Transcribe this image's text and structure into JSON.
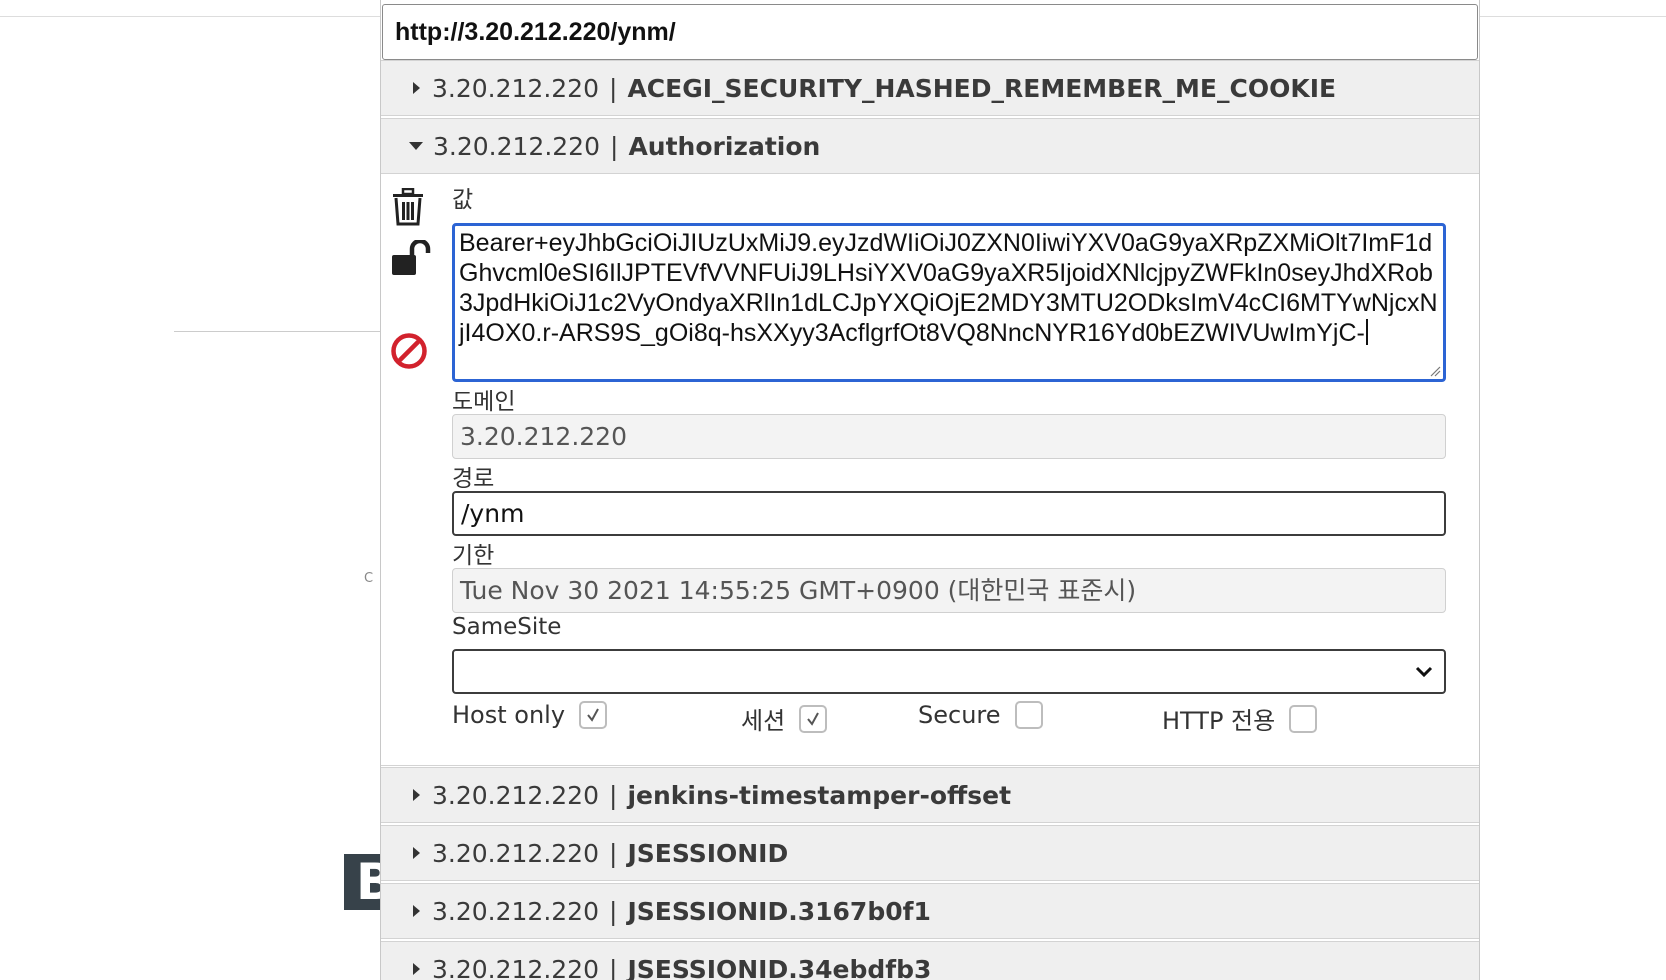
{
  "url": "http://3.20.212.220/ynm/",
  "background": {
    "glyph_small": "C",
    "glyph_block": "B"
  },
  "cookies_before": [
    {
      "domain": "3.20.212.220",
      "name": "ACEGI_SECURITY_HASHED_REMEMBER_ME_COOKIE"
    }
  ],
  "expanded_cookie": {
    "domain": "3.20.212.220",
    "name": "Authorization",
    "icons": {
      "delete": "trash-icon",
      "lock": "unlock-icon",
      "block": "block-icon"
    },
    "value_label": "값",
    "value": "Bearer+eyJhbGciOiJIUzUxMiJ9.eyJzdWIiOiJ0ZXN0IiwiYXV0aG9yaXRpZXMiOlt7ImF1dGhvcml0eSI6IlJPTEVfVVNFUiJ9LHsiYXV0aG9yaXR5IjoidXNlcjpyZWFkIn0seyJhdXRob3JpdHkiOiJ1c2VyOndyaXRlIn1dLCJpYXQiOjE2MDY3MTU2ODksImV4cCI6MTYwNjcxNjI4OX0.r-ARS9S_gOi8q-hsXXyy3AcflgrfOt8VQ8NncNYR16Yd0bEZWIVUwImYjC-",
    "domain_label": "도메인",
    "domain_value": "3.20.212.220",
    "path_label": "경로",
    "path_value": "/ynm",
    "expires_label": "기한",
    "expires_value": "Tue Nov 30 2021 14:55:25 GMT+0900 (대한민국 표준시)",
    "samesite_label": "SameSite",
    "samesite_value": "",
    "flags": {
      "host_only_label": "Host only",
      "host_only": true,
      "session_label": "세션",
      "session": true,
      "secure_label": "Secure",
      "secure": false,
      "http_only_label": "HTTP 전용",
      "http_only": false
    }
  },
  "cookies_after": [
    {
      "domain": "3.20.212.220",
      "name": "jenkins-timestamper-offset"
    },
    {
      "domain": "3.20.212.220",
      "name": "JSESSIONID"
    },
    {
      "domain": "3.20.212.220",
      "name": "JSESSIONID.3167b0f1"
    },
    {
      "domain": "3.20.212.220",
      "name": "JSESSIONID.34ebdfb3"
    }
  ],
  "colors": {
    "focus_border": "#2c64d4",
    "delete_red": "#d2222d",
    "header_bg": "#efefef"
  }
}
